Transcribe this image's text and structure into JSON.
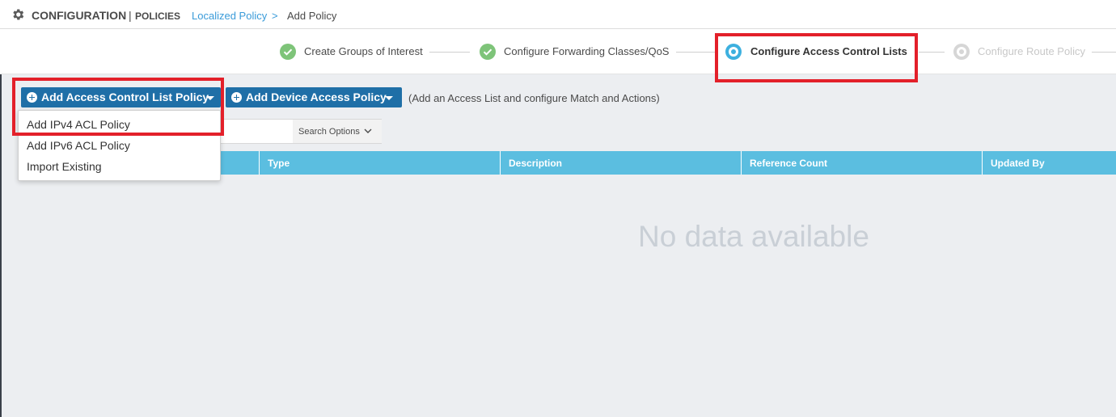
{
  "header": {
    "title": "CONFIGURATION",
    "separator": "|",
    "subtitle": "POLICIES",
    "breadcrumb_link": "Localized Policy",
    "breadcrumb_arrow": ">",
    "breadcrumb_current": "Add Policy",
    "icon": "gear-icon"
  },
  "steps": [
    {
      "label": "Create Groups of Interest",
      "state": "done"
    },
    {
      "label": "Configure Forwarding Classes/QoS",
      "state": "done"
    },
    {
      "label": "Configure Access Control Lists",
      "state": "active"
    },
    {
      "label": "Configure Route Policy",
      "state": "todo"
    }
  ],
  "toolbar": {
    "acl_button": "Add Access Control List Policy",
    "device_button": "Add Device Access Policy",
    "hint": "(Add an Access List and configure Match and Actions)"
  },
  "search": {
    "options_label": "Search Options"
  },
  "dropdown": {
    "items": [
      "Add IPv4 ACL Policy",
      "Add IPv6 ACL Policy",
      "Import Existing"
    ]
  },
  "table": {
    "columns": [
      "Type",
      "Description",
      "Reference Count",
      "Updated By"
    ],
    "empty_message": "No data available"
  },
  "colors": {
    "primary_button": "#1f6fa7",
    "table_header": "#5bbee0",
    "step_done": "#7ec479",
    "step_active": "#3db0df",
    "highlight": "#e3202a",
    "link": "#3a9bd9"
  }
}
